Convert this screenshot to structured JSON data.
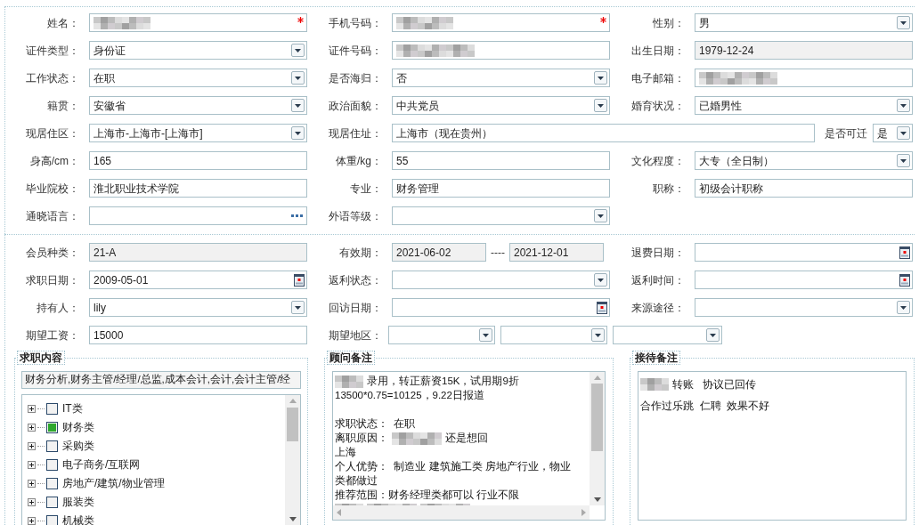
{
  "basic_info": {
    "rows": [
      [
        {
          "label": "姓名：",
          "kind": "required",
          "redacted": true
        },
        {
          "label": "手机号码：",
          "kind": "required",
          "redacted": true
        },
        {
          "label": "性别：",
          "kind": "select",
          "value": "男"
        }
      ],
      [
        {
          "label": "证件类型：",
          "kind": "select",
          "value": "身份证"
        },
        {
          "label": "证件号码：",
          "kind": "text",
          "redacted": true
        },
        {
          "label": "出生日期：",
          "kind": "readonly",
          "value": "1979-12-24"
        }
      ],
      [
        {
          "label": "工作状态：",
          "kind": "select",
          "value": "在职"
        },
        {
          "label": "是否海归：",
          "kind": "select",
          "value": "否"
        },
        {
          "label": "电子邮箱：",
          "kind": "text",
          "redacted": true
        }
      ],
      [
        {
          "label": "籍贯：",
          "kind": "select",
          "value": "安徽省"
        },
        {
          "label": "政治面貌：",
          "kind": "select",
          "value": "中共党员"
        },
        {
          "label": "婚育状况：",
          "kind": "select",
          "value": "已婚男性"
        }
      ],
      [
        {
          "label": "现居住区：",
          "kind": "select",
          "value": "上海市-上海市-[上海市]"
        },
        {
          "label": "现居住址：",
          "kind": "wide_text",
          "value": "上海市（现在贵州）"
        },
        {
          "label": "是否可迁",
          "kind": "inline_select",
          "value": "是"
        }
      ],
      [
        {
          "label": "身高/cm：",
          "kind": "text",
          "value": "165"
        },
        {
          "label": "体重/kg：",
          "kind": "text",
          "value": "55"
        },
        {
          "label": "文化程度：",
          "kind": "select",
          "value": "大专（全日制）"
        }
      ],
      [
        {
          "label": "毕业院校：",
          "kind": "text",
          "value": "淮北职业技术学院"
        },
        {
          "label": "专业：",
          "kind": "text",
          "value": "财务管理"
        },
        {
          "label": "职称：",
          "kind": "text",
          "value": "初级会计职称"
        }
      ],
      [
        {
          "label": "通晓语言：",
          "kind": "lookup"
        },
        {
          "label": "外语等级：",
          "kind": "select"
        }
      ]
    ]
  },
  "membership": {
    "rows": [
      [
        {
          "label": "会员种类：",
          "kind": "readonly",
          "value": "21-A"
        },
        {
          "label": "有效期：",
          "kind": "range",
          "from": {
            "kind": "readonly",
            "value": "2021-06-02"
          },
          "separator": "----",
          "to": {
            "kind": "readonly",
            "value": "2021-12-01"
          }
        },
        {
          "label": "退费日期：",
          "kind": "date"
        }
      ],
      [
        {
          "label": "求职日期：",
          "kind": "date",
          "value": "2009-05-01"
        },
        {
          "label": "返利状态：",
          "kind": "select"
        },
        {
          "label": "返利时间：",
          "kind": "date"
        }
      ],
      [
        {
          "label": "持有人：",
          "kind": "select",
          "value": "lily"
        },
        {
          "label": "回访日期：",
          "kind": "date"
        },
        {
          "label": "来源途径：",
          "kind": "select"
        }
      ],
      [
        {
          "label": "期望工资：",
          "kind": "text",
          "value": "15000"
        },
        {
          "label": "期望地区：",
          "kind": "group",
          "parts": [
            {
              "kind": "select"
            },
            {
              "kind": "select"
            },
            {
              "kind": "select"
            }
          ]
        }
      ]
    ]
  },
  "job_intent": {
    "legend": "求职内容",
    "summary": "财务分析,财务主管/经理/总监,成本会计,会计,会计主管/经",
    "tree": [
      {
        "label": "IT类",
        "checked": false,
        "expanded": false
      },
      {
        "label": "财务类",
        "checked": true,
        "expanded": false
      },
      {
        "label": "采购类",
        "checked": false,
        "expanded": false
      },
      {
        "label": "电子商务/互联网",
        "checked": false,
        "expanded": false
      },
      {
        "label": "房地产/建筑/物业管理",
        "checked": false,
        "expanded": false
      },
      {
        "label": "服装类",
        "checked": false,
        "expanded": false
      },
      {
        "label": "机械类",
        "checked": false,
        "expanded": false
      }
    ]
  },
  "consultant_notes": {
    "legend": "顾问备注",
    "lines": [
      [
        {
          "kind": "redacted"
        },
        {
          "kind": "text",
          "text": "录用，转正薪资15K，试用期9折"
        }
      ],
      [
        {
          "kind": "text",
          "text": "13500*0.75=10125，9.22日报道"
        }
      ],
      [
        {
          "kind": "blank_line"
        }
      ],
      [
        {
          "kind": "text",
          "text": "求职状态：  在职"
        }
      ],
      [
        {
          "kind": "text",
          "text": "离职原因："
        },
        {
          "kind": "redacted"
        },
        {
          "kind": "text",
          "text": "还是想回"
        }
      ],
      [
        {
          "kind": "text",
          "text": "上海"
        }
      ],
      [
        {
          "kind": "text",
          "text": "个人优势：  制造业 建筑施工类 房地产行业，物业"
        }
      ],
      [
        {
          "kind": "text",
          "text": "类都做过"
        }
      ],
      [
        {
          "kind": "text",
          "text": "推荐范围：财务经理类都可以 行业不限"
        }
      ],
      [
        {
          "kind": "redacted"
        },
        {
          "kind": "redacted"
        },
        {
          "kind": "redacted"
        }
      ]
    ]
  },
  "reception_notes": {
    "legend": "接待备注",
    "lines": [
      [
        {
          "kind": "redacted"
        },
        {
          "kind": "text",
          "text": "转账   协议已回传"
        }
      ],
      [
        {
          "kind": "text",
          "text": "合作过乐跳  仁聘  效果不好"
        }
      ]
    ]
  }
}
